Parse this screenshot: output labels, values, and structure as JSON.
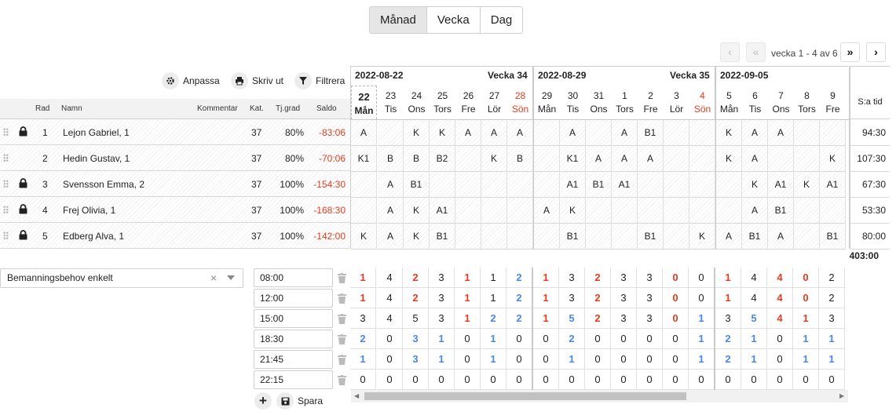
{
  "view_switch": {
    "month": "Månad",
    "week": "Vecka",
    "day": "Dag"
  },
  "pager": {
    "info": "vecka 1 - 4 av 6"
  },
  "toolbar": {
    "customize": "Anpassa",
    "print": "Skriv ut",
    "filter": "Filtrera"
  },
  "columns": {
    "rad": "Rad",
    "namn": "Namn",
    "kommentar": "Kommentar",
    "kat": "Kat.",
    "tjgrad": "Tj.grad",
    "saldo": "Saldo",
    "sum": "S:a tid"
  },
  "weeks": [
    {
      "date": "2022-08-22",
      "label": "Vecka 34"
    },
    {
      "date": "2022-08-29",
      "label": "Vecka 35"
    },
    {
      "date": "2022-09-05",
      "label": ""
    }
  ],
  "days": [
    {
      "n": "22",
      "w": "Mån",
      "today": true
    },
    {
      "n": "23",
      "w": "Tis"
    },
    {
      "n": "24",
      "w": "Ons"
    },
    {
      "n": "25",
      "w": "Tors"
    },
    {
      "n": "26",
      "w": "Fre"
    },
    {
      "n": "27",
      "w": "Lör"
    },
    {
      "n": "28",
      "w": "Sön",
      "sun": true
    },
    {
      "n": "29",
      "w": "Mån"
    },
    {
      "n": "30",
      "w": "Tis"
    },
    {
      "n": "31",
      "w": "Ons"
    },
    {
      "n": "1",
      "w": "Tors"
    },
    {
      "n": "2",
      "w": "Fre"
    },
    {
      "n": "3",
      "w": "Lör"
    },
    {
      "n": "4",
      "w": "Sön",
      "sun": true
    },
    {
      "n": "5",
      "w": "Mån"
    },
    {
      "n": "6",
      "w": "Tis"
    },
    {
      "n": "7",
      "w": "Ons"
    },
    {
      "n": "8",
      "w": "Tors"
    },
    {
      "n": "9",
      "w": "Fre"
    }
  ],
  "rows": [
    {
      "rad": "1",
      "name": "Lejon Gabriel, 1",
      "kat": "37",
      "tj": "80%",
      "saldo": "-83:06",
      "locked": true,
      "sum": "94:30",
      "cells": [
        "A",
        "",
        "K",
        "K",
        "A",
        "A",
        "A",
        "",
        "A",
        "",
        "A",
        "B1",
        "",
        "",
        "K",
        "A",
        "A",
        "",
        ""
      ]
    },
    {
      "rad": "2",
      "name": "Hedin Gustav, 1",
      "kat": "37",
      "tj": "80%",
      "saldo": "-70:06",
      "locked": false,
      "sum": "107:30",
      "cells": [
        "K1",
        "B",
        "B",
        "B2",
        "",
        "K",
        "B",
        "",
        "K1",
        "A",
        "A",
        "A",
        "",
        "",
        "K",
        "A",
        "",
        "",
        "K"
      ]
    },
    {
      "rad": "3",
      "name": "Svensson Emma, 2",
      "kat": "37",
      "tj": "100%",
      "saldo": "-154:30",
      "locked": true,
      "sum": "67:30",
      "cells": [
        "",
        "A",
        "B1",
        "",
        "",
        "",
        "",
        "",
        "A1",
        "B1",
        "A1",
        "",
        "",
        "",
        "",
        "K",
        "A1",
        "K",
        "A1"
      ]
    },
    {
      "rad": "4",
      "name": "Frej Olivia, 1",
      "kat": "37",
      "tj": "100%",
      "saldo": "-168:30",
      "locked": true,
      "sum": "53:30",
      "cells": [
        "",
        "A",
        "K",
        "A1",
        "",
        "",
        "",
        "A",
        "K",
        "",
        "",
        "",
        "",
        "",
        "",
        "A",
        "B1",
        "",
        ""
      ]
    },
    {
      "rad": "5",
      "name": "Edberg Alva, 1",
      "kat": "37",
      "tj": "100%",
      "saldo": "-142:00",
      "locked": true,
      "sum": "80:00",
      "cells": [
        "K",
        "A",
        "K",
        "B1",
        "",
        "",
        "",
        "",
        "B1",
        "",
        "",
        "B1",
        "",
        "K",
        "A",
        "B1",
        "A",
        "",
        "B1"
      ]
    }
  ],
  "total": "403:00",
  "demand": {
    "select_value": "Bemanningsbehov enkelt",
    "save_label": "Spara",
    "times": [
      "08:00",
      "12:00",
      "15:00",
      "18:30",
      "21:45",
      "22:15"
    ],
    "matrix": [
      [
        "1r",
        "4",
        "2r",
        "3",
        "1r",
        "1",
        "2b",
        "1r",
        "3",
        "2r",
        "3",
        "3",
        "0r",
        "0",
        "1r",
        "4",
        "4r",
        "0r",
        "2"
      ],
      [
        "1r",
        "4",
        "2r",
        "3",
        "1r",
        "1",
        "2b",
        "1r",
        "3",
        "2r",
        "3",
        "3",
        "0r",
        "0",
        "1r",
        "4",
        "4r",
        "0r",
        "2"
      ],
      [
        "3",
        "4",
        "5",
        "3",
        "1r",
        "2b",
        "2b",
        "1r",
        "5b",
        "2r",
        "3",
        "3",
        "0r",
        "1b",
        "3",
        "5b",
        "4r",
        "1r",
        "3"
      ],
      [
        "2b",
        "0",
        "3b",
        "1b",
        "0",
        "1b",
        "0",
        "0",
        "2b",
        "0",
        "0",
        "0",
        "0",
        "1b",
        "2b",
        "1b",
        "0",
        "1b",
        "1b"
      ],
      [
        "1b",
        "0",
        "3b",
        "1b",
        "0",
        "1b",
        "0",
        "0",
        "1b",
        "0",
        "0",
        "0",
        "0",
        "1b",
        "2b",
        "1b",
        "0",
        "1b",
        "1b"
      ],
      [
        "0",
        "0",
        "0",
        "0",
        "0",
        "0",
        "0",
        "0",
        "0",
        "0",
        "0",
        "0",
        "0",
        "0",
        "0",
        "0",
        "0",
        "0",
        "0"
      ]
    ]
  },
  "colors": {
    "negative": "#e53b1f",
    "over": "#4a86e8",
    "sunday": "#e53b1f"
  }
}
